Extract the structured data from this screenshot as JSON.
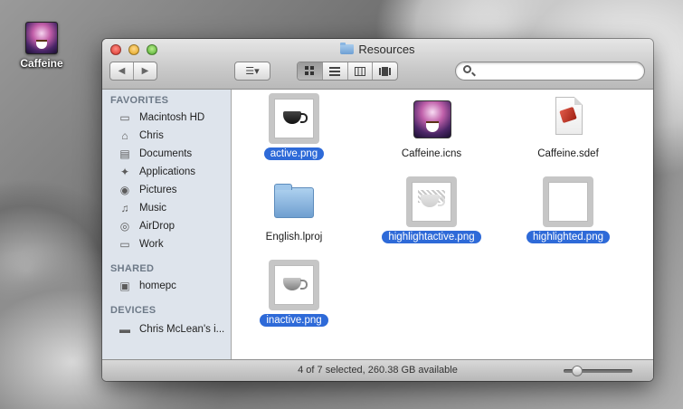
{
  "desktop": {
    "icon_label": "Caffeine"
  },
  "window": {
    "title": "Resources"
  },
  "toolbar": {
    "back_glyph": "◀",
    "forward_glyph": "▶",
    "arrange_glyph": "☰▾",
    "view_icons": [
      "icon-view-icon",
      "list-view-icon",
      "column-view-icon",
      "coverflow-view-icon"
    ],
    "search_value": "",
    "search_placeholder": ""
  },
  "sidebar": {
    "favorites_header": "FAVORITES",
    "favorites": [
      {
        "label": "Macintosh HD",
        "icon": "hard-drive-icon",
        "glyph": "▭"
      },
      {
        "label": "Chris",
        "icon": "home-icon",
        "glyph": "⌂"
      },
      {
        "label": "Documents",
        "icon": "documents-icon",
        "glyph": "▤"
      },
      {
        "label": "Applications",
        "icon": "applications-icon",
        "glyph": "✦"
      },
      {
        "label": "Pictures",
        "icon": "camera-icon",
        "glyph": "◉"
      },
      {
        "label": "Music",
        "icon": "music-icon",
        "glyph": "♫"
      },
      {
        "label": "AirDrop",
        "icon": "airdrop-icon",
        "glyph": "◎"
      },
      {
        "label": "Work",
        "icon": "folder-icon",
        "glyph": "▭"
      }
    ],
    "shared_header": "SHARED",
    "shared": [
      {
        "label": "homepc",
        "icon": "computer-icon",
        "glyph": "▣"
      }
    ],
    "devices_header": "DEVICES",
    "devices": [
      {
        "label": "Chris McLean's i...",
        "icon": "laptop-icon",
        "glyph": "▬"
      }
    ]
  },
  "files": [
    {
      "name": "active.png",
      "selected": true,
      "kind": "image-active"
    },
    {
      "name": "Caffeine.icns",
      "selected": false,
      "kind": "icns"
    },
    {
      "name": "Caffeine.sdef",
      "selected": false,
      "kind": "sdef"
    },
    {
      "name": "English.lproj",
      "selected": false,
      "kind": "folder"
    },
    {
      "name": "highlightactive.png",
      "selected": true,
      "kind": "image-highlightactive"
    },
    {
      "name": "highlighted.png",
      "selected": true,
      "kind": "image-highlighted"
    },
    {
      "name": "inactive.png",
      "selected": true,
      "kind": "image-inactive"
    }
  ],
  "status": {
    "text": "4 of 7 selected, 260.38 GB available",
    "zoom_level": 0.2
  },
  "colors": {
    "selection": "#2e6ad8",
    "sidebar": "#dee4ec"
  }
}
